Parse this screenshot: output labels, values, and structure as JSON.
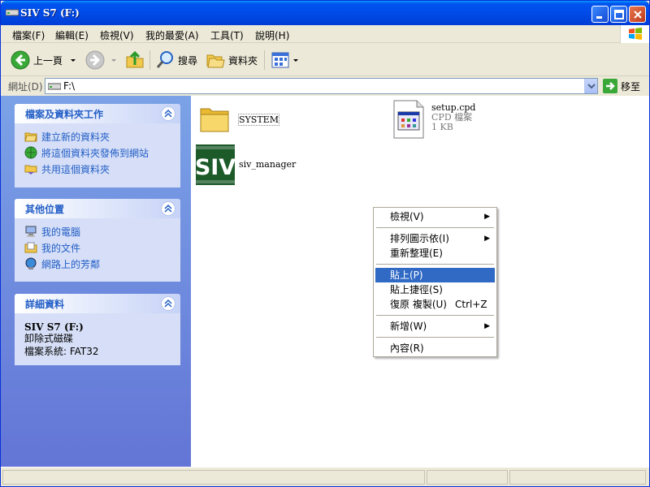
{
  "window": {
    "title": "SIV S7 (F:)"
  },
  "menubar": {
    "items": [
      "檔案(F)",
      "編輯(E)",
      "檢視(V)",
      "我的最愛(A)",
      "工具(T)",
      "說明(H)"
    ]
  },
  "toolbar": {
    "back_label": "上一頁",
    "search_label": "搜尋",
    "folders_label": "資料夾"
  },
  "address": {
    "label": "網址(D)",
    "value": "F:\\",
    "go_label": "移至"
  },
  "left_pane": {
    "tasks": {
      "title": "檔案及資料夾工作",
      "items": [
        "建立新的資料夾",
        "將這個資料夾發佈到網站",
        "共用這個資料夾"
      ]
    },
    "other_places": {
      "title": "其他位置",
      "items": [
        "我的電腦",
        "我的文件",
        "網路上的芳鄰"
      ]
    },
    "details": {
      "title": "詳細資料",
      "name": "SIV S7 (F:)",
      "type": "卸除式磁碟",
      "filesystem": "檔案系統: FAT32"
    }
  },
  "files": [
    {
      "name": "SYSTEM",
      "kind": "folder"
    },
    {
      "name": "setup.cpd",
      "type": "CPD 檔案",
      "size": "1 KB"
    },
    {
      "name": "siv_manager",
      "kind": "app",
      "logo_text": "SIV"
    }
  ],
  "context_menu": {
    "items": [
      {
        "label": "檢視(V)",
        "submenu": true
      },
      {
        "label": "排列圖示依(I)",
        "submenu": true
      },
      {
        "label": "重新整理(E)"
      },
      {
        "label": "貼上(P)",
        "selected": true
      },
      {
        "label": "貼上捷徑(S)"
      },
      {
        "label": "復原 複製(U)",
        "shortcut": "Ctrl+Z"
      },
      {
        "label": "新增(W)",
        "submenu": true
      },
      {
        "label": "內容(R)"
      }
    ]
  },
  "colors": {
    "title_blue": "#0050ee",
    "link_blue": "#215dc6",
    "selection": "#316ac5"
  }
}
